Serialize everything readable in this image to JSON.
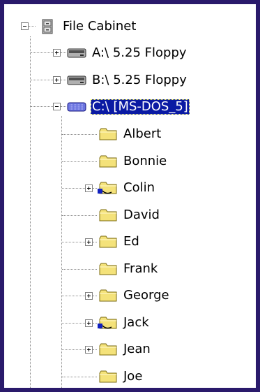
{
  "tree": {
    "root": {
      "label": "File Cabinet",
      "icon": "file-cabinet-icon",
      "expanded": true
    },
    "drives": [
      {
        "label": "A:\\ 5.25 Floppy",
        "icon": "floppy-drive-icon",
        "expanded": false
      },
      {
        "label": "B:\\ 5.25 Floppy",
        "icon": "floppy-drive-icon",
        "expanded": false
      },
      {
        "label": "C:\\ [MS-DOS_5]",
        "icon": "hard-drive-icon",
        "expanded": true,
        "selected": true
      }
    ],
    "folders": [
      {
        "label": "Albert",
        "icon": "folder-icon",
        "expandable": false
      },
      {
        "label": "Bonnie",
        "icon": "folder-icon",
        "expandable": false
      },
      {
        "label": "Colin",
        "icon": "shared-folder-icon",
        "expandable": true
      },
      {
        "label": "David",
        "icon": "folder-icon",
        "expandable": false
      },
      {
        "label": "Ed",
        "icon": "folder-icon",
        "expandable": true
      },
      {
        "label": "Frank",
        "icon": "folder-icon",
        "expandable": false
      },
      {
        "label": "George",
        "icon": "folder-icon",
        "expandable": true
      },
      {
        "label": "Jack",
        "icon": "shared-folder-icon",
        "expandable": true
      },
      {
        "label": "Jean",
        "icon": "folder-icon",
        "expandable": true
      },
      {
        "label": "Joe",
        "icon": "folder-icon",
        "expandable": false
      }
    ]
  },
  "colors": {
    "background": "#2a1a6b",
    "selection": "#0a1aa3",
    "folder_yellow": "#f4e27a"
  }
}
